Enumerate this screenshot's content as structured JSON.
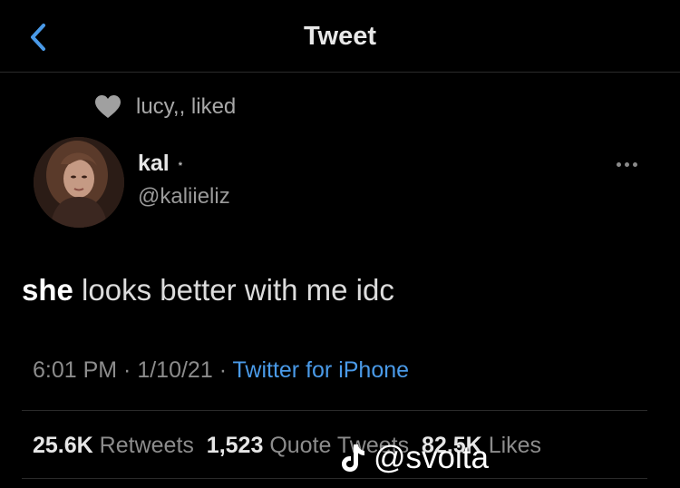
{
  "header": {
    "title": "Tweet",
    "back_icon": "chevron-left-icon"
  },
  "social_context": {
    "text": "lucy,, liked",
    "icon": "heart-icon"
  },
  "author": {
    "name": "kal",
    "badge": "*",
    "handle": "@kaliieliz"
  },
  "tweet": {
    "emphasis": "she",
    "rest": " looks better with me idc"
  },
  "meta": {
    "time": "6:01 PM",
    "sep": " · ",
    "date": "1/10/21",
    "source": "Twitter for iPhone"
  },
  "stats": {
    "retweets": {
      "count": "25.6K",
      "label": "Retweets"
    },
    "quotes": {
      "count": "1,523",
      "label": "Quote Tweets"
    },
    "likes": {
      "count": "82.5K",
      "label": "Likes"
    }
  },
  "watermark": {
    "text": "@svoita",
    "icon": "tiktok-icon"
  },
  "colors": {
    "background": "#000000",
    "link": "#4a9ae8",
    "text": "#d9d9d9",
    "muted": "#8c8c8c"
  }
}
